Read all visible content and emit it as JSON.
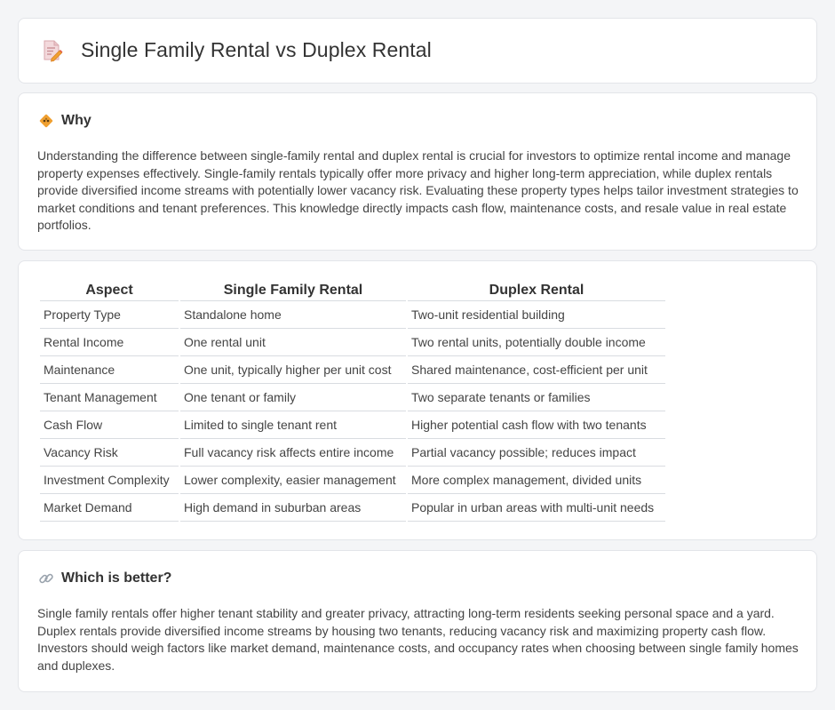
{
  "header": {
    "title": "Single Family Rental vs Duplex Rental",
    "icon": "document-edit-icon"
  },
  "why": {
    "title": "Why",
    "icon": "diamond-warning-icon",
    "text": "Understanding the difference between single-family rental and duplex rental is crucial for investors to optimize rental income and manage property expenses effectively. Single-family rentals typically offer more privacy and higher long-term appreciation, while duplex rentals provide diversified income streams with potentially lower vacancy risk. Evaluating these property types helps tailor investment strategies to market conditions and tenant preferences. This knowledge directly impacts cash flow, maintenance costs, and resale value in real estate portfolios."
  },
  "table": {
    "headers": [
      "Aspect",
      "Single Family Rental",
      "Duplex Rental"
    ],
    "rows": [
      [
        "Property Type",
        "Standalone home",
        "Two-unit residential building"
      ],
      [
        "Rental Income",
        "One rental unit",
        "Two rental units, potentially double income"
      ],
      [
        "Maintenance",
        "One unit, typically higher per unit cost",
        "Shared maintenance, cost-efficient per unit"
      ],
      [
        "Tenant Management",
        "One tenant or family",
        "Two separate tenants or families"
      ],
      [
        "Cash Flow",
        "Limited to single tenant rent",
        "Higher potential cash flow with two tenants"
      ],
      [
        "Vacancy Risk",
        "Full vacancy risk affects entire income",
        "Partial vacancy possible; reduces impact"
      ],
      [
        "Investment Complexity",
        "Lower complexity, easier management",
        "More complex management, divided units"
      ],
      [
        "Market Demand",
        "High demand in suburban areas",
        "Popular in urban areas with multi-unit needs"
      ]
    ]
  },
  "better": {
    "title": "Which is better?",
    "icon": "link-icon",
    "text": "Single family rentals offer higher tenant stability and greater privacy, attracting long-term residents seeking personal space and a yard. Duplex rentals provide diversified income streams by housing two tenants, reducing vacancy risk and maximizing property cash flow. Investors should weigh factors like market demand, maintenance costs, and occupancy rates when choosing between single family homes and duplexes."
  },
  "colors": {
    "background": "#f4f5f7",
    "card": "#ffffff",
    "border": "#e3e5e9",
    "accent_orange": "#f0a030",
    "icon_red": "#e35a4a"
  }
}
